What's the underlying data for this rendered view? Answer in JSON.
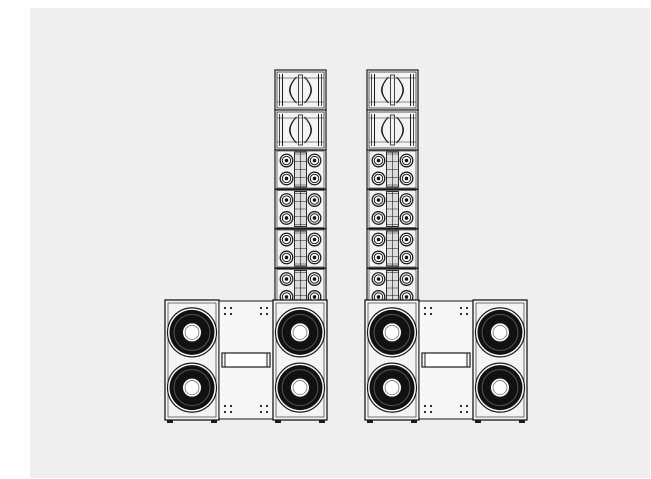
{
  "scene": {
    "background_color": "#efefef",
    "line_color": "#1a1a1a",
    "cabinet_fill": "#f4f4f4",
    "driver_fill": "#111111",
    "columns": [
      {
        "name": "left-line-array",
        "modules": [
          {
            "type": "horn-top-box"
          },
          {
            "type": "horn-top-box"
          },
          {
            "type": "mid-woofer-box"
          },
          {
            "type": "mid-woofer-box"
          },
          {
            "type": "mid-woofer-box"
          },
          {
            "type": "mid-woofer-box"
          },
          {
            "type": "mid-woofer-box"
          }
        ]
      },
      {
        "name": "right-line-array",
        "modules": [
          {
            "type": "horn-top-box"
          },
          {
            "type": "horn-top-box"
          },
          {
            "type": "mid-woofer-box"
          },
          {
            "type": "mid-woofer-box"
          },
          {
            "type": "mid-woofer-box"
          },
          {
            "type": "mid-woofer-box"
          },
          {
            "type": "mid-woofer-box"
          }
        ]
      }
    ],
    "subwoofer_stacks": [
      {
        "name": "left-subwoofer-stack",
        "woofers_per_side": 2,
        "sides": 2
      },
      {
        "name": "right-subwoofer-stack",
        "woofers_per_side": 2,
        "sides": 2
      }
    ]
  }
}
